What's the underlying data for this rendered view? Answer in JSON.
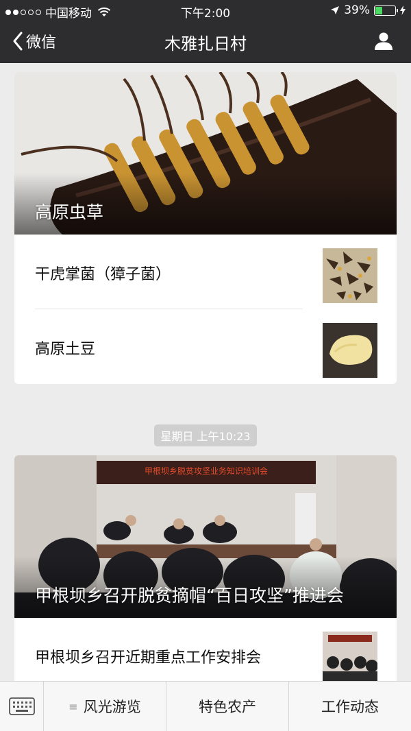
{
  "status": {
    "carrier": "中国移动",
    "time": "下午2:00",
    "battery": "39%",
    "battery_level": 0.39
  },
  "nav": {
    "back_label": "微信",
    "title": "木雅扎日村"
  },
  "card1": {
    "hero_title": "高原虫草",
    "items": [
      {
        "label": "干虎掌菌（獐子菌）"
      },
      {
        "label": "高原土豆"
      }
    ]
  },
  "timestamp": "星期日 上午10:23",
  "card2": {
    "hero_banner": "甲根坝乡脱贫攻坚业务知识培训会",
    "hero_title": "甲根坝乡召开脱贫摘帽“百日攻坚”推进会",
    "items": [
      {
        "label": "甲根坝乡召开近期重点工作安排会"
      }
    ]
  },
  "tabbar": {
    "tabs": [
      {
        "label": "风光游览"
      },
      {
        "label": "特色农产"
      },
      {
        "label": "工作动态"
      }
    ]
  }
}
